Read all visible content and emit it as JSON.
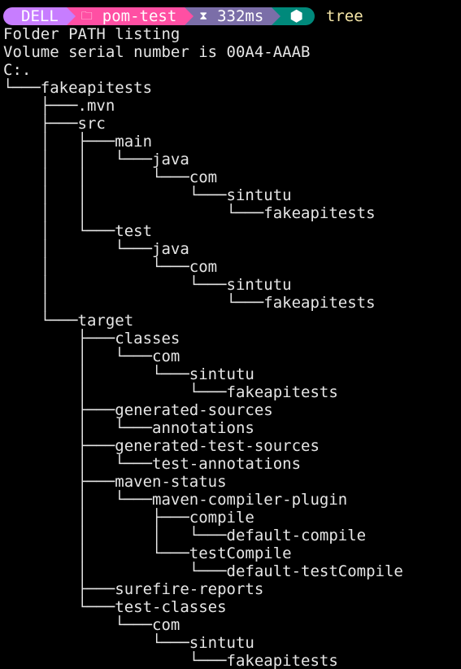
{
  "prompt": {
    "host": "DELL",
    "folder_icon": "folder-icon",
    "folder": "pom-test",
    "timer_icon": "timer-icon",
    "duration": "332ms",
    "runtime_icon": "node-icon",
    "command": "tree"
  },
  "output": {
    "lines": [
      "Folder PATH listing",
      "Volume serial number is 00A4-AAAB",
      "C:.",
      "└───fakeapitests",
      "    ├───.mvn",
      "    ├───src",
      "    │   ├───main",
      "    │   │   └───java",
      "    │   │       └───com",
      "    │   │           └───sintutu",
      "    │   │               └───fakeapitests",
      "    │   └───test",
      "    │       └───java",
      "    │           └───com",
      "    │               └───sintutu",
      "    │                   └───fakeapitests",
      "    └───target",
      "        ├───classes",
      "        │   └───com",
      "        │       └───sintutu",
      "        │           └───fakeapitests",
      "        ├───generated-sources",
      "        │   └───annotations",
      "        ├───generated-test-sources",
      "        │   └───test-annotations",
      "        ├───maven-status",
      "        │   └───maven-compiler-plugin",
      "        │       ├───compile",
      "        │       │   └───default-compile",
      "        │       └───testCompile",
      "        │           └───default-testCompile",
      "        ├───surefire-reports",
      "        └───test-classes",
      "            └───com",
      "                └───sintutu",
      "                    └───fakeapitests"
    ]
  }
}
